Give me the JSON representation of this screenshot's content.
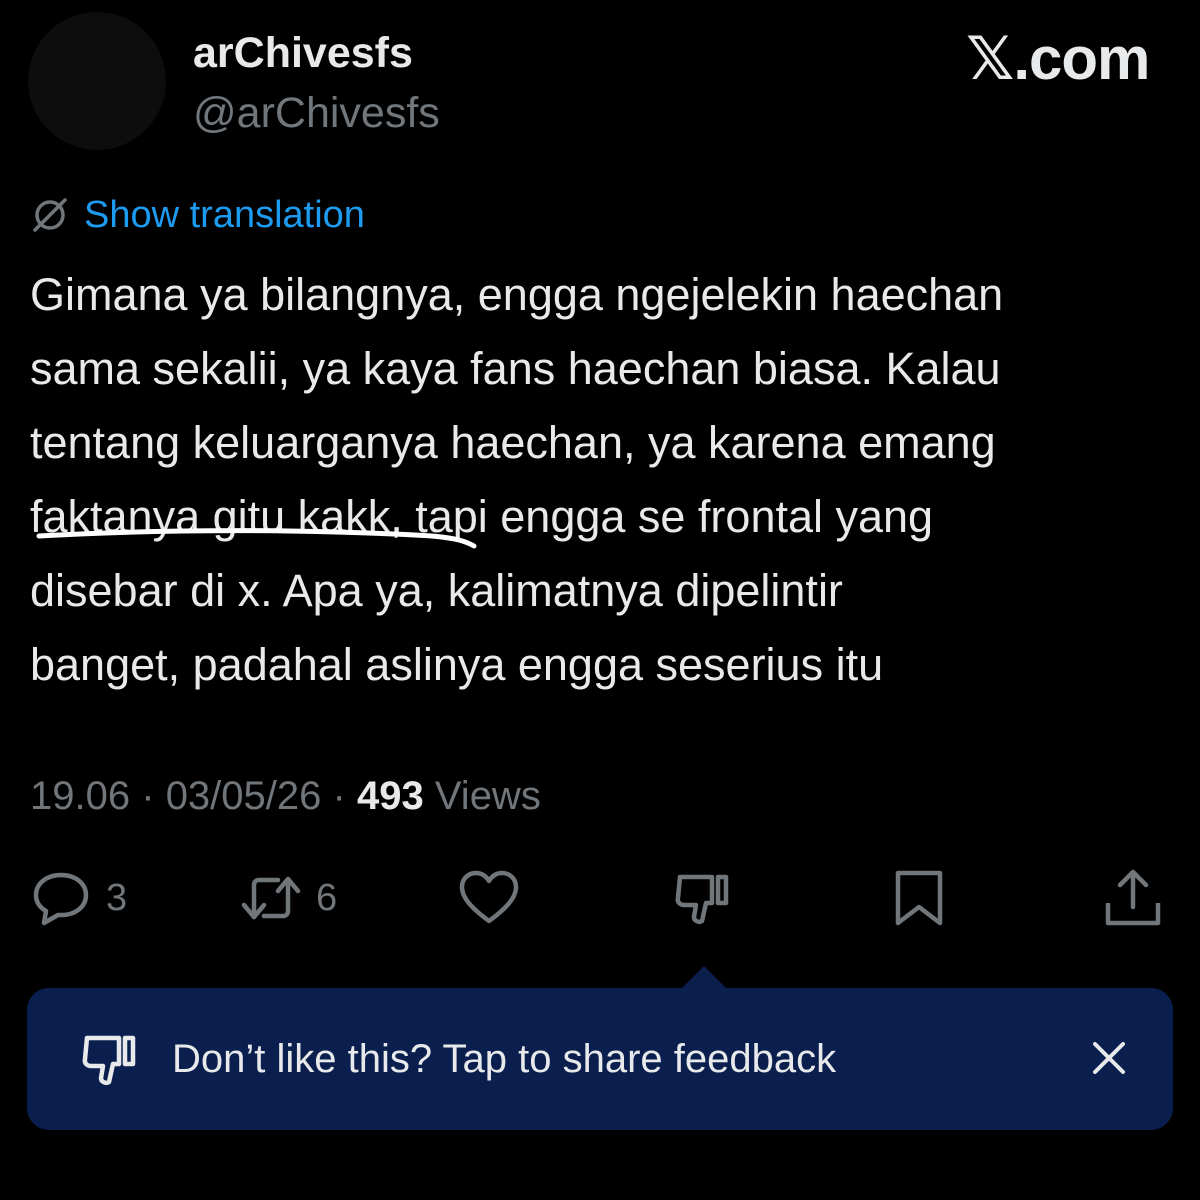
{
  "author": {
    "display_name": "arChivesfs",
    "handle": "@arChivesfs"
  },
  "brand": {
    "label": "𝕏.com"
  },
  "translation": {
    "link_label": "Show translation"
  },
  "post": {
    "lines": [
      "Gimana ya bilangnya, engga ngejelekin haechan",
      "sama sekalii, ya kaya fans haechan biasa. Kalau",
      "tentang keluarganya haechan, ya karena emang",
      "faktanya gitu kakk, tapi engga se frontal yang",
      "disebar di x. Apa ya, kalimatnya dipelintir",
      "banget, padahal aslinya engga seserius itu"
    ]
  },
  "meta": {
    "time": "19.06",
    "separator": "·",
    "date": "03/05/26",
    "views_count": "493",
    "views_label": "Views"
  },
  "actions": {
    "replies": "3",
    "reposts": "6"
  },
  "feedback": {
    "text": "Don’t like this? Tap to share feedback"
  },
  "colors": {
    "background": "#000000",
    "primary_text": "#e7e9ea",
    "secondary_text": "#71767b",
    "link": "#1d9bf0",
    "banner": "#0b1f4f"
  },
  "icons": {
    "translate": "globe-slash-icon",
    "reply": "speech-bubble-icon",
    "repost": "repost-arrows-icon",
    "like": "heart-icon",
    "dislike": "thumbs-down-icon",
    "bookmark": "bookmark-icon",
    "share": "share-upload-icon",
    "close": "close-icon"
  }
}
